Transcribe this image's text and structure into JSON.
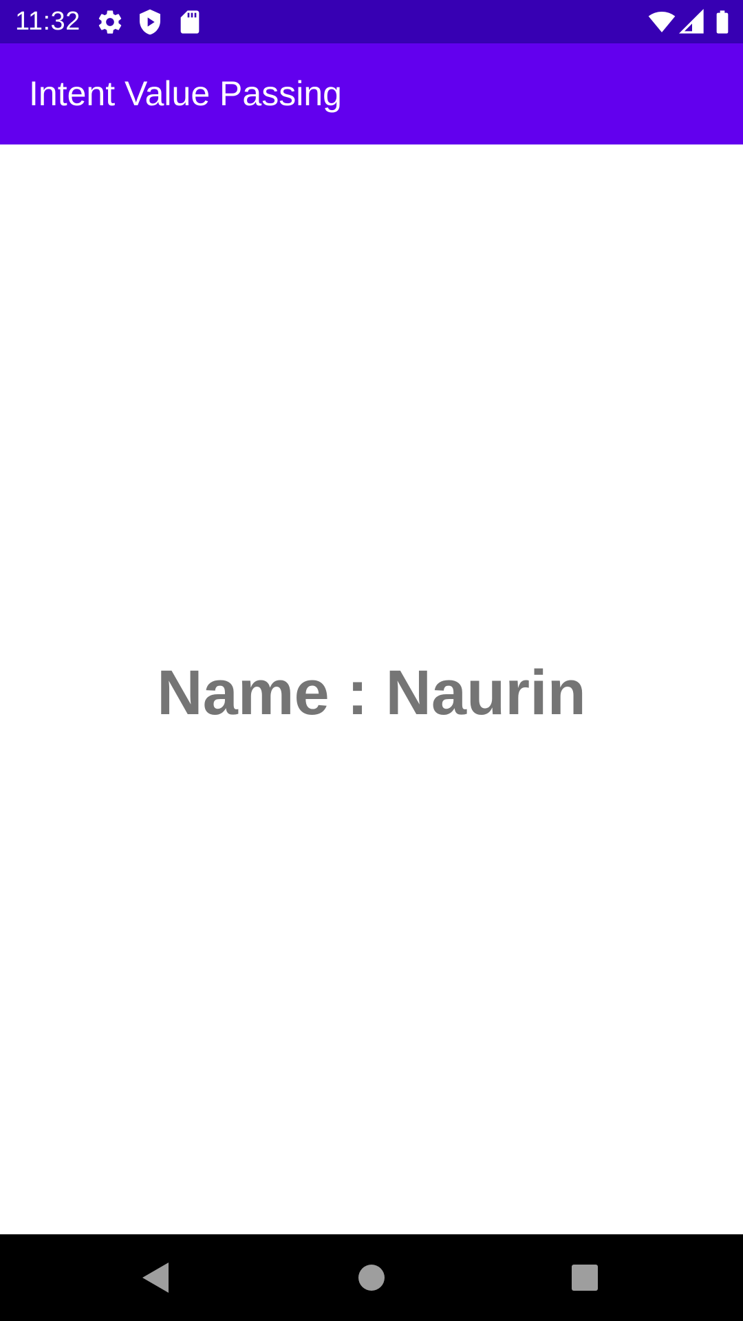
{
  "status_bar": {
    "time": "11:32",
    "left_icons": [
      "gear-icon",
      "shield-play-icon",
      "sd-card-icon"
    ],
    "right_icons": [
      "wifi-icon",
      "cell-signal-icon",
      "battery-icon"
    ]
  },
  "app_bar": {
    "title": "Intent Value Passing",
    "color": "#6200EE"
  },
  "main": {
    "name_text": "Name : Naurin",
    "text_color": "#757575"
  },
  "nav_bar": {
    "buttons": [
      "back-icon",
      "home-icon",
      "recents-icon"
    ]
  },
  "colors": {
    "status_bar": "#3700B3",
    "app_bar": "#6200EE",
    "background": "#FFFFFF",
    "nav_bar": "#000000"
  }
}
